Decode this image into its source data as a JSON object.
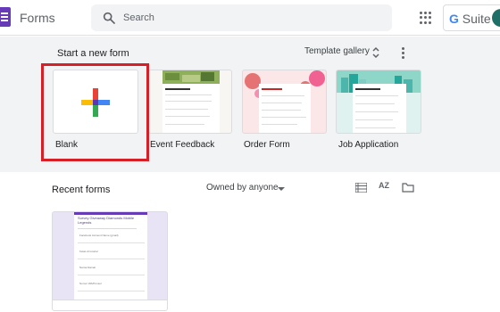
{
  "app": {
    "title": "Forms",
    "suite_prefix": "G",
    "suite_label": " Suite"
  },
  "search": {
    "placeholder": "Search"
  },
  "templates": {
    "title": "Start a new form",
    "gallery_label": "Template gallery",
    "cards": [
      {
        "label": "Blank"
      },
      {
        "label": "Event Feedback"
      },
      {
        "label": "Order Form"
      },
      {
        "label": "Job Application"
      }
    ]
  },
  "recent": {
    "title": "Recent forms",
    "owner_filter": "Owned by anyone",
    "sort_label": "AZ",
    "document_title": "Survey Giveaway Diamonds Mobile Legends",
    "document_fields": [
      "Facebook Account Name (gmail)",
      "Kelas di tutorial",
      "Nama Alamat",
      "Nomor WA/Ponsel"
    ]
  },
  "colors": {
    "forms_purple": "#673ab7",
    "highlight_red": "#d61f26",
    "google_blue": "#4285f4",
    "google_red": "#ea4335",
    "google_yellow": "#fbbc05",
    "google_green": "#34a853"
  },
  "icons": {
    "search": "search-icon",
    "apps": "apps-grid-icon",
    "sort": "sort-az-icon",
    "folder": "folder-icon",
    "list": "list-view-icon"
  }
}
